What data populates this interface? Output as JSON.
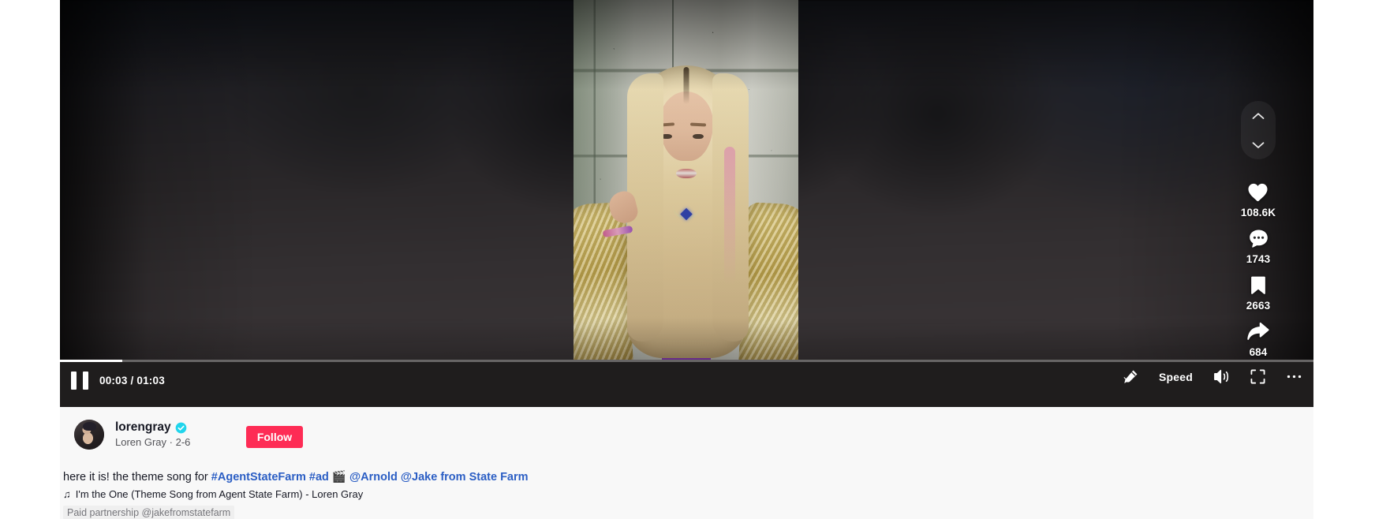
{
  "player": {
    "time_current": "00:03",
    "time_total": "01:03",
    "time_display": "00:03 / 01:03",
    "progress_percent": 5,
    "pause_icon": "pause-icon",
    "speed_label": "Speed",
    "clear_mode_icon": "clear-mode-icon",
    "volume_icon": "volume-icon",
    "fullscreen_icon": "fullscreen-icon",
    "more_icon": "more-options-icon"
  },
  "nav": {
    "up_icon": "chevron-up-icon",
    "down_icon": "chevron-down-icon"
  },
  "actions": [
    {
      "name": "like",
      "icon": "heart-icon",
      "count": "108.6K"
    },
    {
      "name": "comment",
      "icon": "comment-icon",
      "count": "1743"
    },
    {
      "name": "bookmark",
      "icon": "bookmark-icon",
      "count": "2663"
    },
    {
      "name": "share",
      "icon": "share-icon",
      "count": "684"
    }
  ],
  "author": {
    "username": "lorengray",
    "verified": true,
    "verified_icon": "verified-badge-icon",
    "display_line": "Loren Gray · 2-6",
    "nickname": "Loren Gray",
    "date": "2-6",
    "follow_label": "Follow"
  },
  "post": {
    "caption_prefix": "here it is! the theme song for ",
    "caption_tag1": "#AgentStateFarm",
    "caption_space1": " ",
    "caption_tag2": "#ad",
    "caption_emoji": "🎬",
    "caption_mention1": "@Arnold",
    "caption_space2": " ",
    "caption_mention2": "@Jake from State Farm",
    "music_note": "♫",
    "music_title": "I'm the One (Theme Song from Agent State Farm) - Loren Gray",
    "paid_partnership": "Paid partnership @jakefromstatefarm"
  },
  "colors": {
    "brand_red": "#fe2c55",
    "link_blue": "#2b5ec4",
    "verified_blue": "#20d5ec",
    "panel_bg": "#f8f8f8",
    "control_bg": "#1f1d1d"
  }
}
